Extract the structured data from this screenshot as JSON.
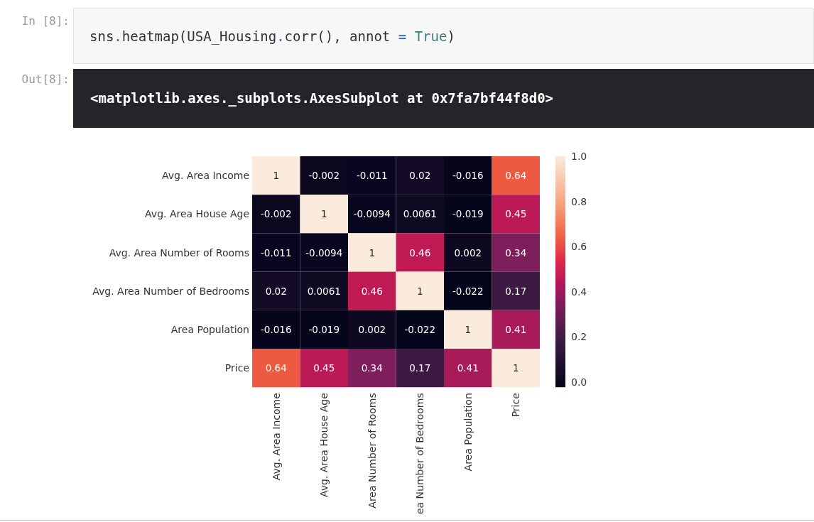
{
  "input_cell": {
    "prompt": "In [8]:",
    "code": [
      {
        "kind": "name",
        "text": "sns"
      },
      {
        "kind": "operator",
        "text": "."
      },
      {
        "kind": "name",
        "text": "heatmap(USA_Housing"
      },
      {
        "kind": "operator",
        "text": "."
      },
      {
        "kind": "name",
        "text": "corr(), annot"
      },
      {
        "kind": "operator",
        "text": " = "
      },
      {
        "kind": "constant",
        "text": "True"
      },
      {
        "kind": "name",
        "text": ")"
      }
    ]
  },
  "output_cell": {
    "prompt": "Out[8]:",
    "text": "<matplotlib.axes._subplots.AxesSubplot at 0x7fa7bf44f8d0>",
    "heatmap": {
      "rows": [
        {
          "label": "Avg. Area Income",
          "cells": [
            {
              "text": "1",
              "color": "#faebdd"
            },
            {
              "text": "-0.002",
              "color": "#0b071e"
            },
            {
              "text": "-0.011",
              "color": "#080620"
            },
            {
              "text": "0.02",
              "color": "#140c26"
            },
            {
              "text": "-0.016",
              "color": "#06051c"
            },
            {
              "text": "0.64",
              "color": "#ee5a3f"
            }
          ]
        },
        {
          "label": "Avg. Area House Age",
          "cells": [
            {
              "text": "-0.002",
              "color": "#0b071e"
            },
            {
              "text": "1",
              "color": "#faebdd"
            },
            {
              "text": "-0.0094",
              "color": "#090620"
            },
            {
              "text": "0.0061",
              "color": "#0f0a22"
            },
            {
              "text": "-0.019",
              "color": "#05051b"
            },
            {
              "text": "0.45",
              "color": "#bc1a56"
            }
          ]
        },
        {
          "label": "Avg. Area Number of Rooms",
          "cells": [
            {
              "text": "-0.011",
              "color": "#080620"
            },
            {
              "text": "-0.0094",
              "color": "#090620"
            },
            {
              "text": "1",
              "color": "#faebdd"
            },
            {
              "text": "0.46",
              "color": "#c01a55"
            },
            {
              "text": "0.002",
              "color": "#0e0921"
            },
            {
              "text": "0.34",
              "color": "#7e1e5a"
            }
          ]
        },
        {
          "label": "Avg. Area Number of Bedrooms",
          "cells": [
            {
              "text": "0.02",
              "color": "#140c26"
            },
            {
              "text": "0.0061",
              "color": "#0f0a22"
            },
            {
              "text": "0.46",
              "color": "#c01a55"
            },
            {
              "text": "1",
              "color": "#faebdd"
            },
            {
              "text": "-0.022",
              "color": "#03051a"
            },
            {
              "text": "0.17",
              "color": "#3d1a42"
            }
          ]
        },
        {
          "label": "Area Population",
          "cells": [
            {
              "text": "-0.016",
              "color": "#06051c"
            },
            {
              "text": "-0.019",
              "color": "#05051b"
            },
            {
              "text": "0.002",
              "color": "#0e0921"
            },
            {
              "text": "-0.022",
              "color": "#03051a"
            },
            {
              "text": "1",
              "color": "#faebdd"
            },
            {
              "text": "0.41",
              "color": "#a81b58"
            }
          ]
        },
        {
          "label": "Price",
          "cells": [
            {
              "text": "0.64",
              "color": "#ee5a3f"
            },
            {
              "text": "0.45",
              "color": "#bc1a56"
            },
            {
              "text": "0.34",
              "color": "#7e1e5a"
            },
            {
              "text": "0.17",
              "color": "#3d1a42"
            },
            {
              "text": "0.41",
              "color": "#a81b58"
            },
            {
              "text": "1",
              "color": "#faebdd"
            }
          ]
        }
      ],
      "bottom_axis_labels": [
        "Avg. Area Income",
        "Avg. Area House Age",
        "Area Number of Rooms",
        "ea Number of Bedrooms",
        "Area Population",
        "Price"
      ],
      "colorbar": {
        "ticks": [
          "1.0",
          "0.8",
          "0.6",
          "0.4",
          "0.2",
          "0.0"
        ]
      }
    }
  }
}
